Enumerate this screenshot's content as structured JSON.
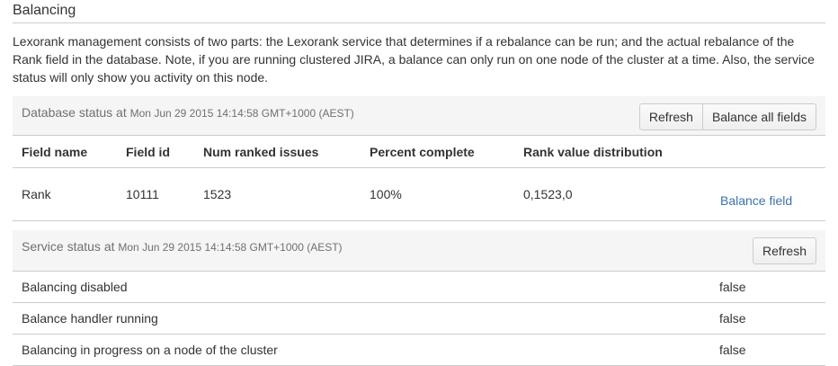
{
  "section": {
    "title": "Balancing",
    "description": "Lexorank management consists of two parts: the Lexorank service that determines if a rebalance can be run; and the actual rebalance of the Rank field in the database. Note, if you are running clustered JIRA, a balance can only run on one node of the cluster at a time. Also, the service status will only show you activity on this node."
  },
  "database_status": {
    "label": "Database status at",
    "timestamp": "Mon Jun 29 2015 14:14:58 GMT+1000 (AEST)",
    "refresh_label": "Refresh",
    "balance_all_label": "Balance all fields",
    "columns": [
      "Field name",
      "Field id",
      "Num ranked issues",
      "Percent complete",
      "Rank value distribution"
    ],
    "rows": [
      {
        "field_name": "Rank",
        "field_id": "10111",
        "num_ranked": "1523",
        "percent": "100%",
        "distribution": "0,1523,0",
        "action": "Balance field"
      }
    ]
  },
  "service_status": {
    "label": "Service status at",
    "timestamp": "Mon Jun 29 2015 14:14:58 GMT+1000 (AEST)",
    "refresh_label": "Refresh",
    "rows": [
      {
        "label": "Balancing disabled",
        "value": "false"
      },
      {
        "label": "Balance handler running",
        "value": "false"
      },
      {
        "label": "Balancing in progress on a node of the cluster",
        "value": "false"
      }
    ]
  }
}
